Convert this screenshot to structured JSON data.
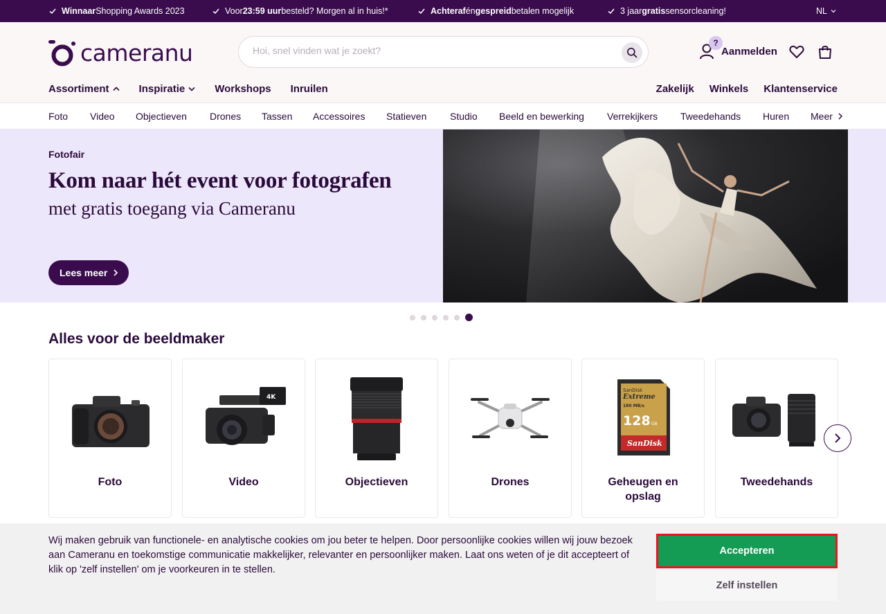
{
  "promo": {
    "items": [
      {
        "bold": "Winnaar",
        "text": " Shopping Awards 2023"
      },
      {
        "pre": "Voor ",
        "bold": "23:59 uur",
        "text": " besteld? Morgen al in huis!*"
      },
      {
        "bold": "Achteraf",
        "mid": " én ",
        "bold2": "gespreid",
        "text": " betalen mogelijk"
      },
      {
        "pre": "3 jaar ",
        "bold": "gratis",
        "text": " sensorcleaning!"
      }
    ],
    "language": "NL"
  },
  "header": {
    "logo_text": "cameranu",
    "search_placeholder": "Hoi, snel vinden wat je zoekt?",
    "account_badge": "?",
    "account_label": "Aanmelden"
  },
  "mainnav": {
    "left": [
      "Assortiment",
      "Inspiratie",
      "Workshops",
      "Inruilen"
    ],
    "right": [
      "Zakelijk",
      "Winkels",
      "Klantenservice"
    ]
  },
  "categories": [
    "Foto",
    "Video",
    "Objectieven",
    "Drones",
    "Tassen",
    "Accessoires",
    "Statieven",
    "Studio",
    "Beeld en bewerking",
    "Verrekijkers",
    "Tweedehands",
    "Huren",
    "Meer"
  ],
  "hero": {
    "eyebrow": "Fotofair",
    "title": "Kom naar hét event voor fotografen",
    "subtitle": "met gratis toegang via Cameranu",
    "button": "Lees meer",
    "slides": 6,
    "active_slide": 6
  },
  "section": {
    "title": "Alles voor de beeldmaker",
    "cards": [
      "Foto",
      "Video",
      "Objectieven",
      "Drones",
      "Geheugen en opslag",
      "Tweedehands"
    ]
  },
  "cookie": {
    "text": "Wij maken gebruik van functionele- en analytische cookies om jou beter te helpen. Door persoonlijke cookies willen wij jouw bezoek aan Cameranu en toekomstige communicatie makkelijker, relevanter en persoonlijker maken. Laat ons weten of je dit accepteert of klik op 'zelf instellen' om je voorkeuren in te stellen.",
    "accept": "Accepteren",
    "settings": "Zelf instellen"
  },
  "colors": {
    "brand": "#3a0c4e",
    "hero_bg": "#ede7fb",
    "accept_green": "#149c55",
    "highlight_red": "#e8161b"
  }
}
